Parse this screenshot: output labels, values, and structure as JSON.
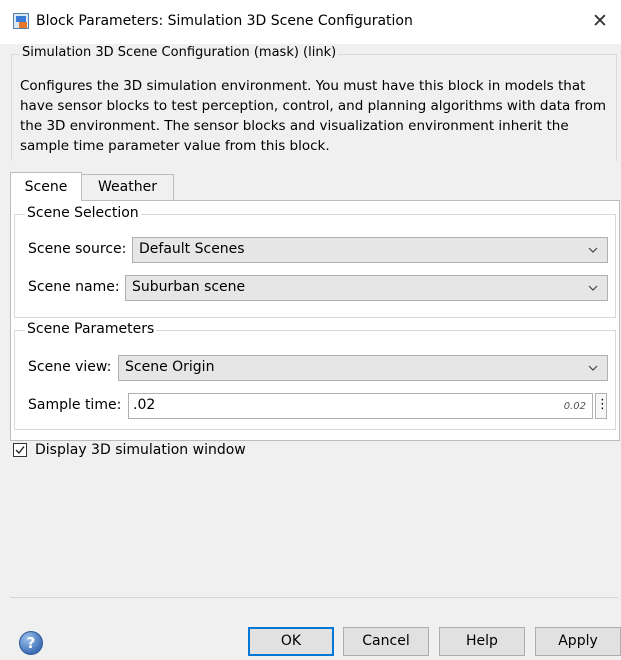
{
  "window": {
    "title": "Block Parameters: Simulation 3D Scene Configuration",
    "close_glyph": "✕",
    "icon": "simulink-block-icon"
  },
  "mask": {
    "caption": "Simulation 3D Scene Configuration (mask) (link)",
    "description": "Configures the 3D simulation environment. You must have this block in models that have sensor blocks to test perception, control, and planning algorithms with data from the 3D environment. The sensor blocks and visualization environment inherit the sample time parameter value from this block."
  },
  "tabs": [
    {
      "label": "Scene",
      "active": true
    },
    {
      "label": "Weather",
      "active": false
    }
  ],
  "scene_selection": {
    "title": "Scene Selection",
    "scene_source": {
      "label": "Scene source:",
      "value": "Default Scenes"
    },
    "scene_name": {
      "label": "Scene name:",
      "value": "Suburban scene"
    }
  },
  "scene_parameters": {
    "title": "Scene Parameters",
    "scene_view": {
      "label": "Scene view:",
      "value": "Scene Origin"
    },
    "sample_time": {
      "label": "Sample time:",
      "value": ".02",
      "evaluated": "0.02",
      "more_glyph": "⋮"
    }
  },
  "display_window": {
    "label": "Display 3D simulation window",
    "checked": true
  },
  "buttons": {
    "ok": "OK",
    "cancel": "Cancel",
    "help": "Help",
    "apply": "Apply"
  },
  "help_icon": {
    "glyph": "?"
  },
  "colors": {
    "accent": "#0078d7",
    "panel": "#ffffff",
    "dialog": "#f0f0f0",
    "dropdown": "#e6e6e6"
  }
}
